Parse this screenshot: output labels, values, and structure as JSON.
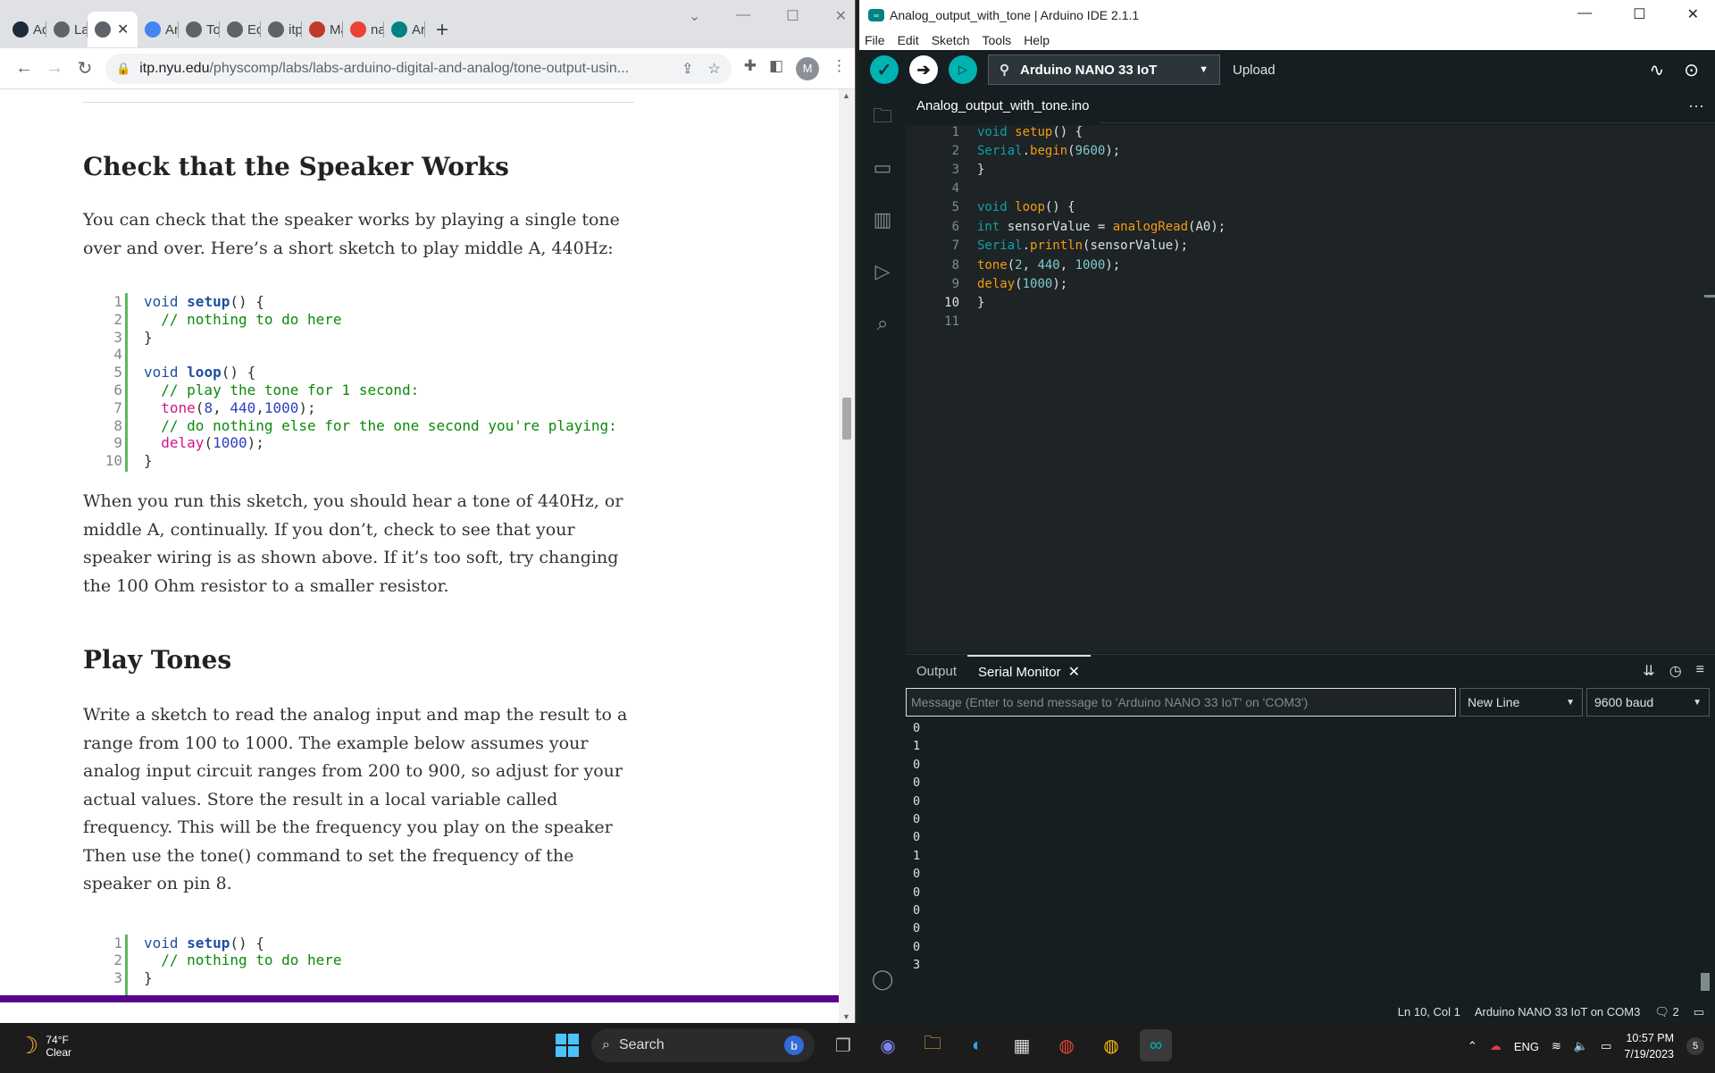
{
  "chrome": {
    "tabs": [
      {
        "label": "Ad",
        "icon": "pf-icon",
        "color": "#1e2a3a"
      },
      {
        "label": "Lab",
        "icon": "globe-icon",
        "color": "#5f6368"
      },
      {
        "label": "",
        "icon": "globe-icon",
        "color": "#5f6368",
        "active": true
      },
      {
        "label": "An",
        "icon": "docs-icon",
        "color": "#4285f4"
      },
      {
        "label": "Toc",
        "icon": "pen-icon",
        "color": "#5f6368"
      },
      {
        "label": "Equ",
        "icon": "globe-icon",
        "color": "#5f6368"
      },
      {
        "label": "itp.",
        "icon": "globe-icon",
        "color": "#5f6368"
      },
      {
        "label": "Ma",
        "icon": "oc-icon",
        "color": "#c0392b"
      },
      {
        "label": "nar",
        "icon": "google-icon",
        "color": "#ea4335"
      },
      {
        "label": "Arc",
        "icon": "arduino-icon",
        "color": "#008184"
      }
    ],
    "new_tab": "+",
    "url_host": "itp.nyu.edu",
    "url_path": "/physcomp/labs/labs-arduino-digital-and-analog/tone-output-usin...",
    "profile_initial": "M"
  },
  "article": {
    "heading1": "Check that the Speaker Works",
    "para1": "You can check that the speaker works by playing a single tone over and over. Here’s a short sketch to play middle A, 440Hz:",
    "code1_lines": [
      "1",
      "2",
      "3",
      "4",
      "5",
      "6",
      "7",
      "8",
      "9",
      "10"
    ],
    "para2": "When you run this sketch, you should hear a tone of 440Hz, or middle A, continually. If you don’t, check to see that your speaker wiring is as shown above. If it’s too soft, try changing the 100 Ohm resistor to a smaller resistor.",
    "heading2": "Play Tones",
    "para3": "Write a sketch to read the analog input and map the result to a range from 100 to 1000. The example below assumes your analog input circuit ranges from 200 to 900, so adjust for your actual values.  Store the result in a local variable called frequency. This will be the frequency you play on the speaker Then use the tone() command to set the frequency of the speaker on pin 8.",
    "code2_lines": [
      "1",
      "2",
      "3"
    ]
  },
  "ide": {
    "window_title": "Analog_output_with_tone | Arduino IDE 2.1.1",
    "menu": [
      "File",
      "Edit",
      "Sketch",
      "Tools",
      "Help"
    ],
    "board": "Arduino NANO 33 IoT",
    "upload_label": "Upload",
    "file_tab": "Analog_output_with_tone.ino",
    "line_numbers": [
      "1",
      "2",
      "3",
      "4",
      "5",
      "6",
      "7",
      "8",
      "9",
      "10",
      "11"
    ],
    "current_line": 10,
    "panel_tabs": {
      "output": "Output",
      "serial": "Serial Monitor"
    },
    "message_placeholder": "Message (Enter to send message to 'Arduino NANO 33 IoT' on 'COM3')",
    "line_ending": "New Line",
    "baud": "9600 baud",
    "serial_lines": [
      "0",
      "1",
      "0",
      "0",
      "0",
      "0",
      "0",
      "1",
      "0",
      "0",
      "0",
      "0",
      "0",
      "3"
    ],
    "status_position": "Ln 10, Col 1",
    "status_board": "Arduino NANO 33 IoT on COM3",
    "status_notifications": "2"
  },
  "taskbar": {
    "temperature": "74°F",
    "condition": "Clear",
    "search_label": "Search",
    "language": "ENG",
    "time": "10:57 PM",
    "date": "7/19/2023",
    "notification_count": "5"
  }
}
